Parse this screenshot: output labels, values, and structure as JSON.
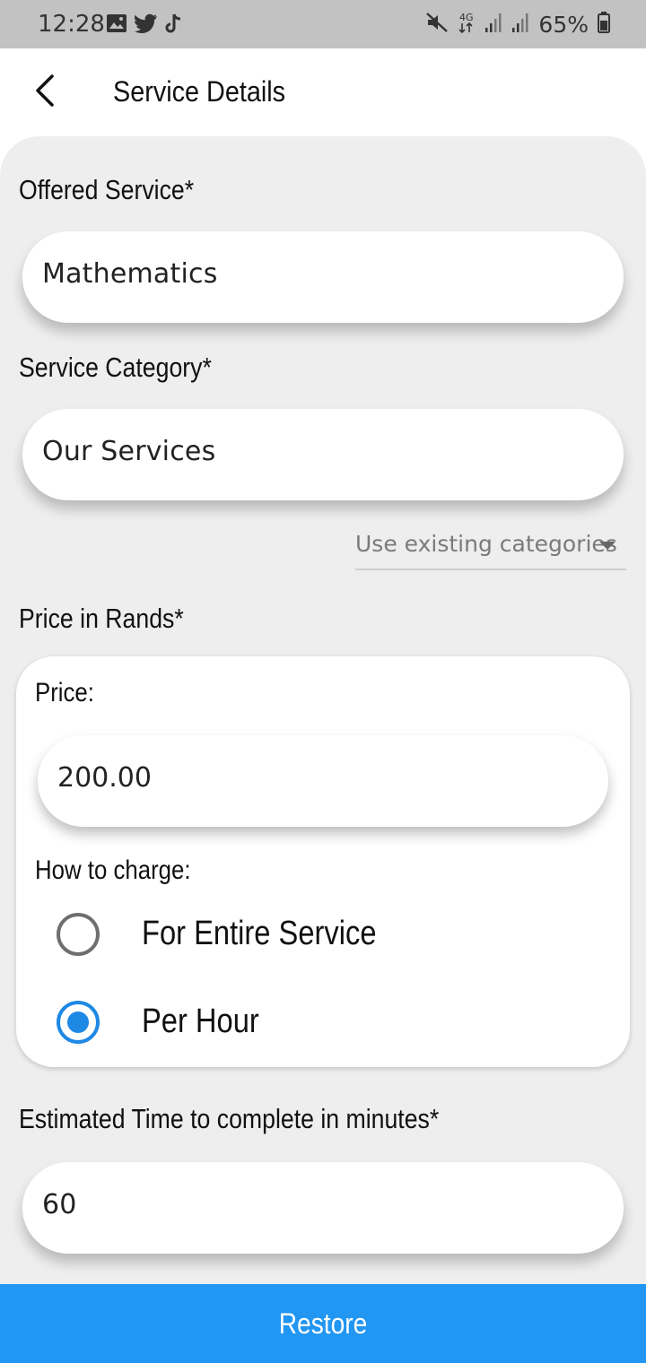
{
  "status_bar": {
    "time": "12:28",
    "battery": "65%",
    "icons": [
      "gallery-icon",
      "twitter-icon",
      "tiktok-icon",
      "mute-icon",
      "4g-icon",
      "signal-icon",
      "signal-icon",
      "battery-icon"
    ]
  },
  "app_bar": {
    "title": "Service Details",
    "back_icon": "chevron-left-icon"
  },
  "form": {
    "offered_service": {
      "label": "Offered Service*",
      "value": "Mathematics"
    },
    "service_category": {
      "label": "Service Category*",
      "value": "Our Services",
      "dropdown_text": "Use existing categories"
    },
    "price": {
      "label": "Price in Rands*",
      "price_label": "Price:",
      "value": "200.00",
      "charge_label": "How to charge:",
      "options": [
        {
          "label": "For Entire Service",
          "selected": false
        },
        {
          "label": "Per Hour",
          "selected": true
        }
      ]
    },
    "estimated_time": {
      "label": "Estimated Time to complete in minutes*",
      "value": "60"
    }
  },
  "restore_button": {
    "label": "Restore"
  },
  "colors": {
    "accent": "#2196f3",
    "radio_selected": "#1e88e5",
    "background": "#eeeeee",
    "status_bar": "#c2c2c2"
  }
}
